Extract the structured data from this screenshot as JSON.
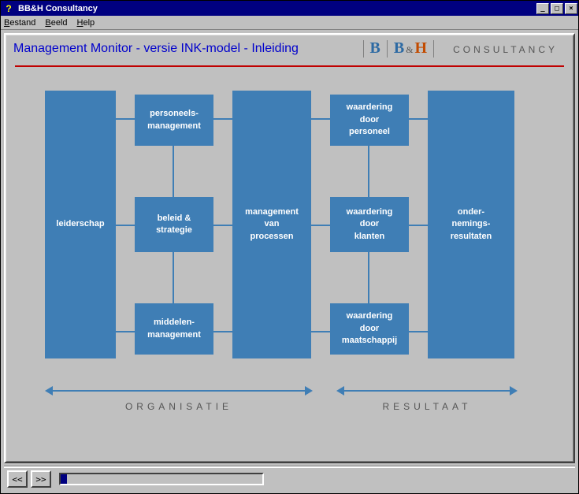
{
  "window": {
    "title": "BB&H Consultancy"
  },
  "menubar": {
    "items": [
      "Bestand",
      "Beeld",
      "Help"
    ]
  },
  "header": {
    "page_title": "Management Monitor - versie INK-model - Inleiding"
  },
  "logo": {
    "b1": "B",
    "b2": "B",
    "amp": "&",
    "h": "H",
    "consultancy": "CONSULTANCY"
  },
  "diagram": {
    "leiderschap": "leiderschap",
    "personeels": "personeels-\nmanagement",
    "beleid": "beleid &\nstrategie",
    "middelen": "middelen-\nmanagement",
    "processen": "management\nvan\nprocessen",
    "waard_pers": "waardering\ndoor\npersoneel",
    "waard_klant": "waardering\ndoor\nklanten",
    "waard_maat": "waardering\ndoor\nmaatschappij",
    "resultaten": "onder-\nnemings-\nresultaten"
  },
  "arrows": {
    "org_label": "ORGANISATIE",
    "res_label": "RESULTAAT"
  },
  "nav": {
    "prev": "<<",
    "next": ">>"
  }
}
